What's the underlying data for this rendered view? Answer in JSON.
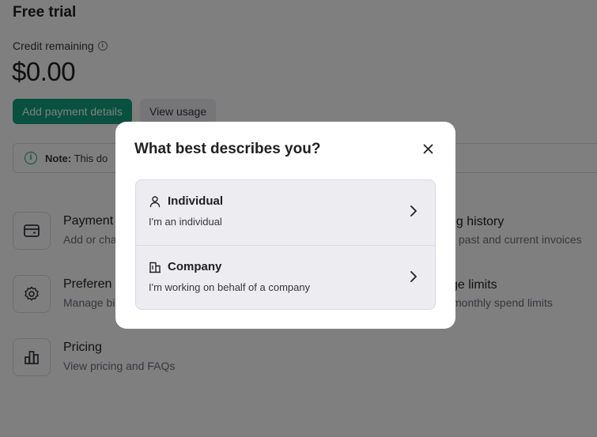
{
  "page": {
    "title": "Free trial",
    "credit_label": "Credit remaining",
    "info_icon": "info-icon",
    "amount": "$0.00",
    "add_payment_label": "Add payment details",
    "view_usage_label": "View usage",
    "note_prefix": "Note:",
    "note_text": "This do",
    "cards": [
      {
        "icon": "credit-card-icon",
        "title": "Payment",
        "sub": "Add or cha"
      },
      {
        "icon": "gear-icon",
        "title": "Preferen",
        "sub": "Manage bi"
      },
      {
        "icon": "bar-chart-icon",
        "title": "Pricing",
        "sub": "View pricing and FAQs"
      }
    ],
    "right_cards": [
      {
        "title": "ng history",
        "sub": "past and current invoices"
      },
      {
        "title": "ge limits",
        "sub": "monthly spend limits"
      }
    ]
  },
  "modal": {
    "title": "What best describes you?",
    "close_icon": "close-icon",
    "options": [
      {
        "icon": "person-icon",
        "label": "Individual",
        "sub": "I'm an individual"
      },
      {
        "icon": "building-icon",
        "label": "Company",
        "sub": "I'm working on behalf of a company"
      }
    ]
  },
  "colors": {
    "accent": "#10a37f",
    "overlay": "rgba(0,0,0,0.5)",
    "option_bg": "#ececf1"
  }
}
